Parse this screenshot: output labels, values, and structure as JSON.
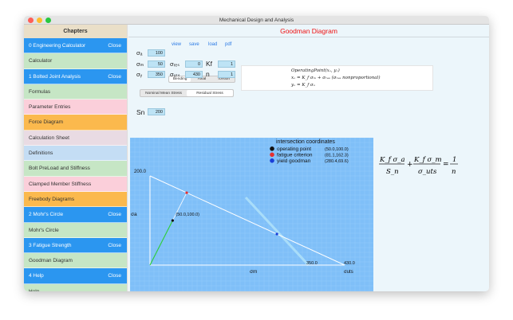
{
  "window": {
    "title": "Mechanical Design and Analysis"
  },
  "colors": {
    "blue": "#2b96f0",
    "green": "#c6e6c5",
    "pink": "#fbcfda",
    "orange": "#fbb94d",
    "lavender": "#e9dbe3",
    "lightblue": "#c4ddf4",
    "plot_bg": "#7fbff8"
  },
  "sidebar": {
    "header": "Chapters",
    "items": [
      {
        "label": "0 Engineering Calculator",
        "close": "Close",
        "color": "blue"
      },
      {
        "label": "Calculator",
        "color": "green"
      },
      {
        "label": "1 Bolted Joint Analysis",
        "close": "Close",
        "color": "blue"
      },
      {
        "label": "Formulas",
        "color": "green"
      },
      {
        "label": "Parameter Entries",
        "color": "pink"
      },
      {
        "label": "Force Diagram",
        "color": "orange"
      },
      {
        "label": "Calculation Sheet",
        "color": "lavender"
      },
      {
        "label": "Definitions",
        "color": "lightblue"
      },
      {
        "label": "Bolt PreLoad and Stiffness",
        "color": "green"
      },
      {
        "label": "Clamped Member Stiffness",
        "color": "pink"
      },
      {
        "label": "Freebody Diagrams",
        "color": "orange"
      },
      {
        "label": "2 Mohr's Circle",
        "close": "Close",
        "color": "blue"
      },
      {
        "label": "Mohr's Circle",
        "color": "green"
      },
      {
        "label": "3 Fatigue Strength",
        "close": "Close",
        "color": "blue"
      },
      {
        "label": "Goodman Diagram",
        "color": "green"
      },
      {
        "label": "4 Help",
        "close": "Close",
        "color": "blue"
      },
      {
        "label": "Help",
        "color": "green"
      }
    ]
  },
  "main": {
    "title": "Goodman Diagram",
    "actions": [
      "view",
      "save",
      "load",
      "pdf"
    ],
    "inputs": {
      "sa_label": "σₐ",
      "sa": "100",
      "sm_label": "σₘ",
      "sm": "50",
      "sy_label": "σᵧ",
      "sy": "350",
      "sres_label": "σᵣₑₛ",
      "sres": "0",
      "suts_label": "σᵤₜₛ",
      "suts": "430",
      "kf_label": "Kf",
      "kf": "1",
      "n_label": "n",
      "n": "1",
      "sn_label": "Sn",
      "sn": "200"
    },
    "load_tabs": [
      "Bending",
      "Axial",
      "Torsion"
    ],
    "stress_tabs": [
      "Nominal Mean Stress",
      "Residual Stress"
    ],
    "equations": [
      "OperatingPoint(xₒ, yₒ)",
      "xₒ = K_f σₘ + σᵣₑₛ  (σᵣₑₛ nonproportional)",
      "yₒ = K_f σₐ"
    ],
    "goodman_eq": {
      "num1": "K_f σ_a",
      "den1": "S_n",
      "num2": "K_f σ_m",
      "den2": "σ_uts",
      "rhs_num": "1",
      "rhs_den": "n"
    }
  },
  "chart_data": {
    "type": "scatter",
    "title": "intersection coordinates",
    "xlabel": "σm",
    "ylabel": "σa",
    "xlim": [
      0,
      430
    ],
    "ylim": [
      0,
      200
    ],
    "grid": true,
    "axis_labels": {
      "y_top": "200.0",
      "x_right": "430.0",
      "x_sy": "350.0",
      "x_uts": "σuts",
      "op_label": "(50.0,100.0)"
    },
    "legend": [
      {
        "name": "operating point",
        "coords": "(50.0,100.0)",
        "color": "#111111"
      },
      {
        "name": "fatigue criterion",
        "coords": "(81.1,162.3)",
        "color": "#e53030"
      },
      {
        "name": "yield goodman",
        "coords": "(280.4,69.6)",
        "color": "#1a3fd8"
      }
    ],
    "lines": {
      "goodman": [
        [
          0,
          200
        ],
        [
          430,
          0
        ]
      ],
      "load_line": [
        [
          0,
          0
        ],
        [
          81.1,
          162.3
        ]
      ],
      "yield_line": [
        [
          0,
          350
        ],
        [
          350,
          0
        ]
      ]
    },
    "points": [
      {
        "name": "operating point",
        "x": 50,
        "y": 100
      },
      {
        "name": "fatigue criterion",
        "x": 81.1,
        "y": 162.3
      },
      {
        "name": "yield goodman",
        "x": 280.4,
        "y": 69.6
      }
    ]
  }
}
